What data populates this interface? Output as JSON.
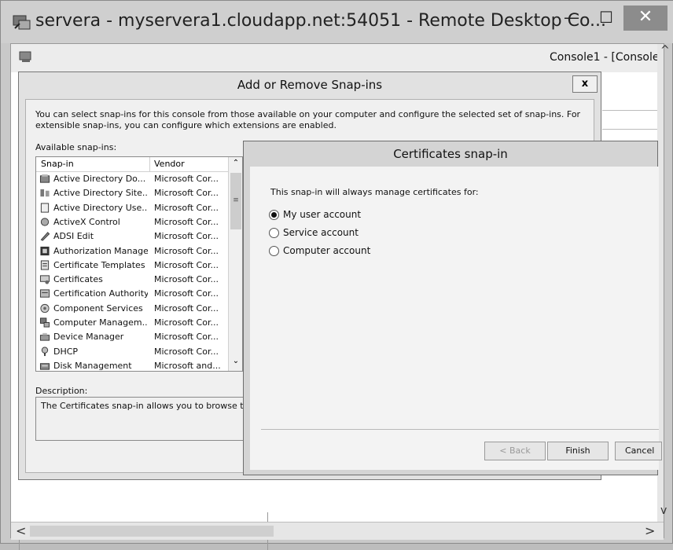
{
  "window": {
    "title": "servera - myservera1.cloudapp.net:54051 - Remote Desktop Co...",
    "minimize": "—",
    "maximize": "☐",
    "close": "✕"
  },
  "console": {
    "title": "Console1 - [Console",
    "scroll_left": "<",
    "scroll_right": ">",
    "scroll_up": "^",
    "scroll_down": "v"
  },
  "snapins_dialog": {
    "title": "Add or Remove Snap-ins",
    "close": "x",
    "description": "You can select snap-ins for this console from those available on your computer and configure the selected set of snap-ins. For extensible snap-ins, you can configure which extensions are enabled.",
    "available_label": "Available snap-ins:",
    "columns": {
      "snapin": "Snap-in",
      "vendor": "Vendor"
    },
    "rows": [
      {
        "name": "Active Directory Do...",
        "vendor": "Microsoft Cor...",
        "icon": "directory-icon"
      },
      {
        "name": "Active Directory Site...",
        "vendor": "Microsoft Cor...",
        "icon": "sites-icon"
      },
      {
        "name": "Active Directory Use...",
        "vendor": "Microsoft Cor...",
        "icon": "users-icon"
      },
      {
        "name": "ActiveX Control",
        "vendor": "Microsoft Cor...",
        "icon": "activex-icon"
      },
      {
        "name": "ADSI Edit",
        "vendor": "Microsoft Cor...",
        "icon": "adsi-icon"
      },
      {
        "name": "Authorization Manager",
        "vendor": "Microsoft Cor...",
        "icon": "authorization-icon"
      },
      {
        "name": "Certificate Templates",
        "vendor": "Microsoft Cor...",
        "icon": "templates-icon"
      },
      {
        "name": "Certificates",
        "vendor": "Microsoft Cor...",
        "icon": "certificates-icon"
      },
      {
        "name": "Certification Authority",
        "vendor": "Microsoft Cor...",
        "icon": "ca-icon"
      },
      {
        "name": "Component Services",
        "vendor": "Microsoft Cor...",
        "icon": "component-icon"
      },
      {
        "name": "Computer Managem...",
        "vendor": "Microsoft Cor...",
        "icon": "computer-management-icon"
      },
      {
        "name": "Device Manager",
        "vendor": "Microsoft Cor...",
        "icon": "device-icon"
      },
      {
        "name": "DHCP",
        "vendor": "Microsoft Cor...",
        "icon": "dhcp-icon"
      },
      {
        "name": "Disk Management",
        "vendor": "Microsoft and...",
        "icon": "disk-icon"
      }
    ],
    "description_label": "Description:",
    "description_text": "The Certificates snap-in allows you to browse the"
  },
  "cert_wizard": {
    "title": "Certificates snap-in",
    "prompt": "This snap-in will always manage certificates for:",
    "options": [
      {
        "label": "My user account",
        "selected": true
      },
      {
        "label": "Service account",
        "selected": false
      },
      {
        "label": "Computer account",
        "selected": false
      }
    ],
    "back": "< Back",
    "finish": "Finish",
    "cancel": "Cancel"
  }
}
